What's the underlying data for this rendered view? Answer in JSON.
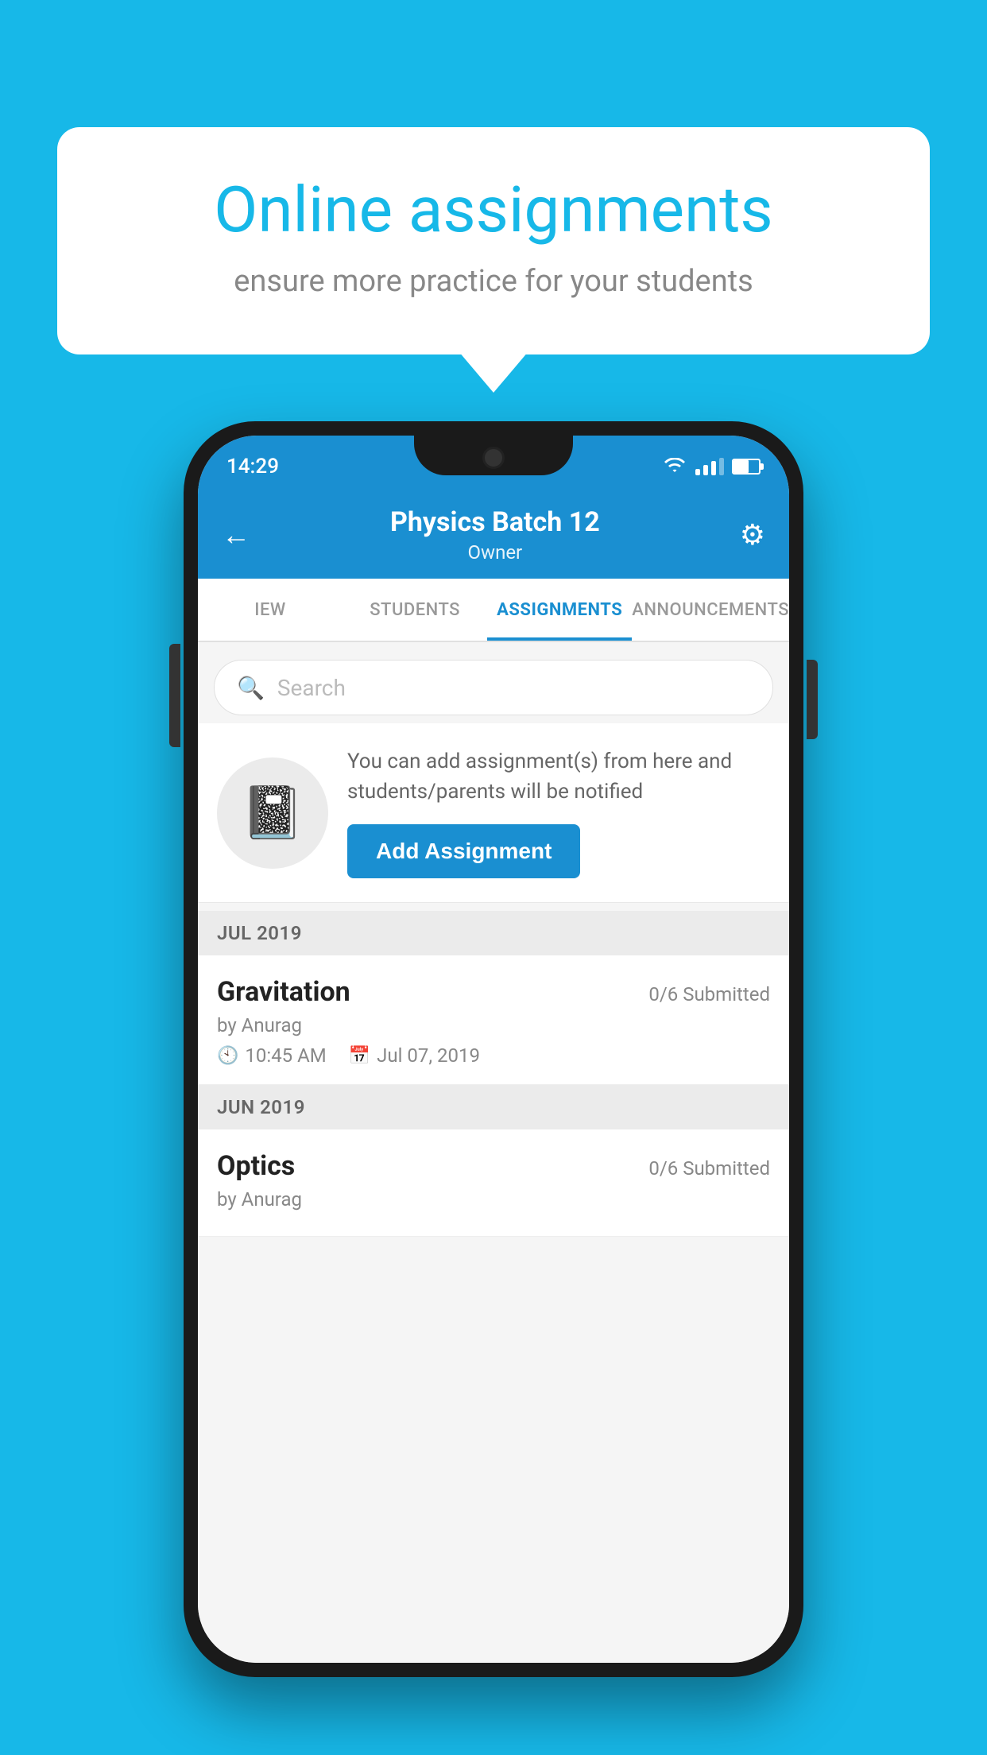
{
  "background_color": "#17b8e8",
  "bubble": {
    "title": "Online assignments",
    "subtitle": "ensure more practice for your students"
  },
  "status_bar": {
    "time": "14:29",
    "wifi": true,
    "battery_level": "60%"
  },
  "header": {
    "title": "Physics Batch 12",
    "subtitle": "Owner",
    "back_label": "←",
    "settings_label": "⚙"
  },
  "tabs": [
    {
      "label": "IEW",
      "active": false
    },
    {
      "label": "STUDENTS",
      "active": false
    },
    {
      "label": "ASSIGNMENTS",
      "active": true
    },
    {
      "label": "ANNOUNCEMENTS",
      "active": false
    }
  ],
  "search": {
    "placeholder": "Search"
  },
  "info_card": {
    "description": "You can add assignment(s) from here and students/parents will be notified",
    "button_label": "Add Assignment"
  },
  "sections": [
    {
      "header": "JUL 2019",
      "assignments": [
        {
          "name": "Gravitation",
          "submitted": "0/6 Submitted",
          "by": "by Anurag",
          "time": "10:45 AM",
          "date": "Jul 07, 2019"
        }
      ]
    },
    {
      "header": "JUN 2019",
      "assignments": [
        {
          "name": "Optics",
          "submitted": "0/6 Submitted",
          "by": "by Anurag",
          "time": "",
          "date": ""
        }
      ]
    }
  ]
}
